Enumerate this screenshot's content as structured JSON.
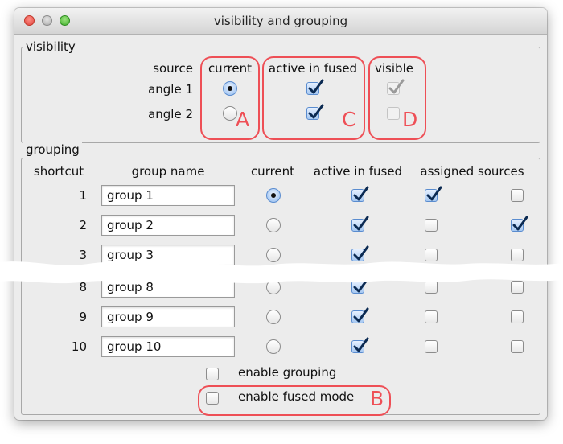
{
  "window": {
    "title": "visibility and grouping"
  },
  "visibility": {
    "legend": "visibility",
    "headers": {
      "source": "source",
      "current": "current",
      "active": "active in fused",
      "visible": "visible"
    },
    "rows": [
      {
        "label": "angle 1",
        "current": true,
        "active": true,
        "visible": true
      },
      {
        "label": "angle 2",
        "current": false,
        "active": true,
        "visible": false
      }
    ]
  },
  "grouping": {
    "legend": "grouping",
    "headers": {
      "shortcut": "shortcut",
      "group_name": "group name",
      "current": "current",
      "active": "active in fused",
      "assigned": "assigned sources"
    },
    "rows": [
      {
        "shortcut": "1",
        "name": "group 1",
        "current": true,
        "active": true,
        "assigned": [
          true,
          false
        ]
      },
      {
        "shortcut": "2",
        "name": "group 2",
        "current": false,
        "active": true,
        "assigned": [
          false,
          true
        ]
      },
      {
        "shortcut": "3",
        "name": "group 3",
        "current": false,
        "active": true,
        "assigned": [
          false,
          false
        ]
      },
      {
        "shortcut": "8",
        "name": "group 8",
        "current": false,
        "active": true,
        "assigned": [
          false,
          false
        ]
      },
      {
        "shortcut": "9",
        "name": "group 9",
        "current": false,
        "active": true,
        "assigned": [
          false,
          false
        ]
      },
      {
        "shortcut": "10",
        "name": "group 10",
        "current": false,
        "active": true,
        "assigned": [
          false,
          false
        ]
      }
    ],
    "enable_grouping": "enable grouping",
    "enable_fused": "enable fused mode"
  },
  "annotations": {
    "a": "A",
    "b": "B",
    "c": "C",
    "d": "D"
  },
  "colors": {
    "annotation": "#ee4f56",
    "check": "#0b2a52",
    "radio_selected": "#8fb9ee"
  }
}
